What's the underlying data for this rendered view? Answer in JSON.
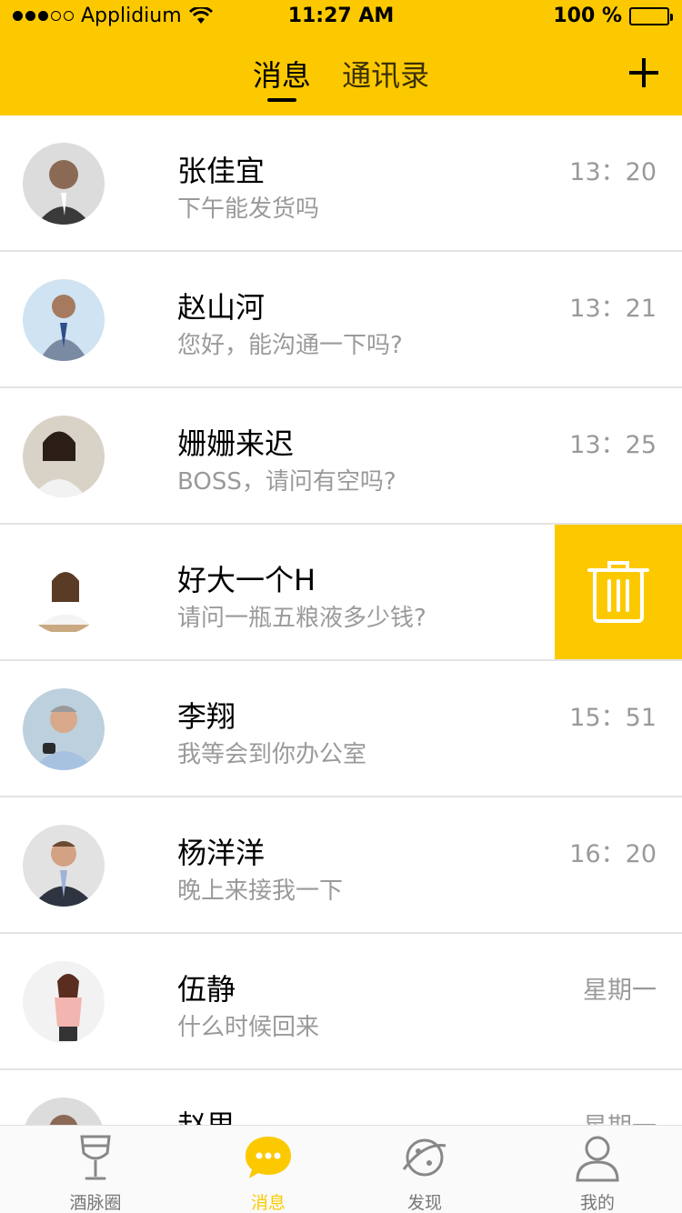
{
  "status_bar": {
    "carrier": "Applidium",
    "time": "11:27 AM",
    "battery": "100 %"
  },
  "header": {
    "tabs": [
      {
        "label": "消息",
        "active": true
      },
      {
        "label": "通讯录",
        "active": false
      }
    ],
    "accent_color": "#fcc900"
  },
  "conversations": [
    {
      "name": "张佳宜",
      "message": "下午能发货吗",
      "time": "13：20"
    },
    {
      "name": "赵山河",
      "message": "您好，能沟通一下吗?",
      "time": "13：21"
    },
    {
      "name": "姗姗来迟",
      "message": "BOSS，请问有空吗?",
      "time": "13：25"
    },
    {
      "name": "好大一个H",
      "message": "请问一瓶五粮液多少钱?",
      "time": "",
      "swiped": true
    },
    {
      "name": "李翔",
      "message": "我等会到你办公室",
      "time": "15：51"
    },
    {
      "name": "杨洋洋",
      "message": "晚上来接我一下",
      "time": "16：20"
    },
    {
      "name": "伍静",
      "message": "什么时候回来",
      "time": "星期一"
    },
    {
      "name": "赵思",
      "message": "",
      "time": "星期一"
    }
  ],
  "tabbar": {
    "items": [
      {
        "label": "酒脉圈",
        "icon": "wine-glass-icon",
        "active": false
      },
      {
        "label": "消息",
        "icon": "chat-bubble-icon",
        "active": true
      },
      {
        "label": "发现",
        "icon": "planet-icon",
        "active": false
      },
      {
        "label": "我的",
        "icon": "person-icon",
        "active": false
      }
    ]
  }
}
